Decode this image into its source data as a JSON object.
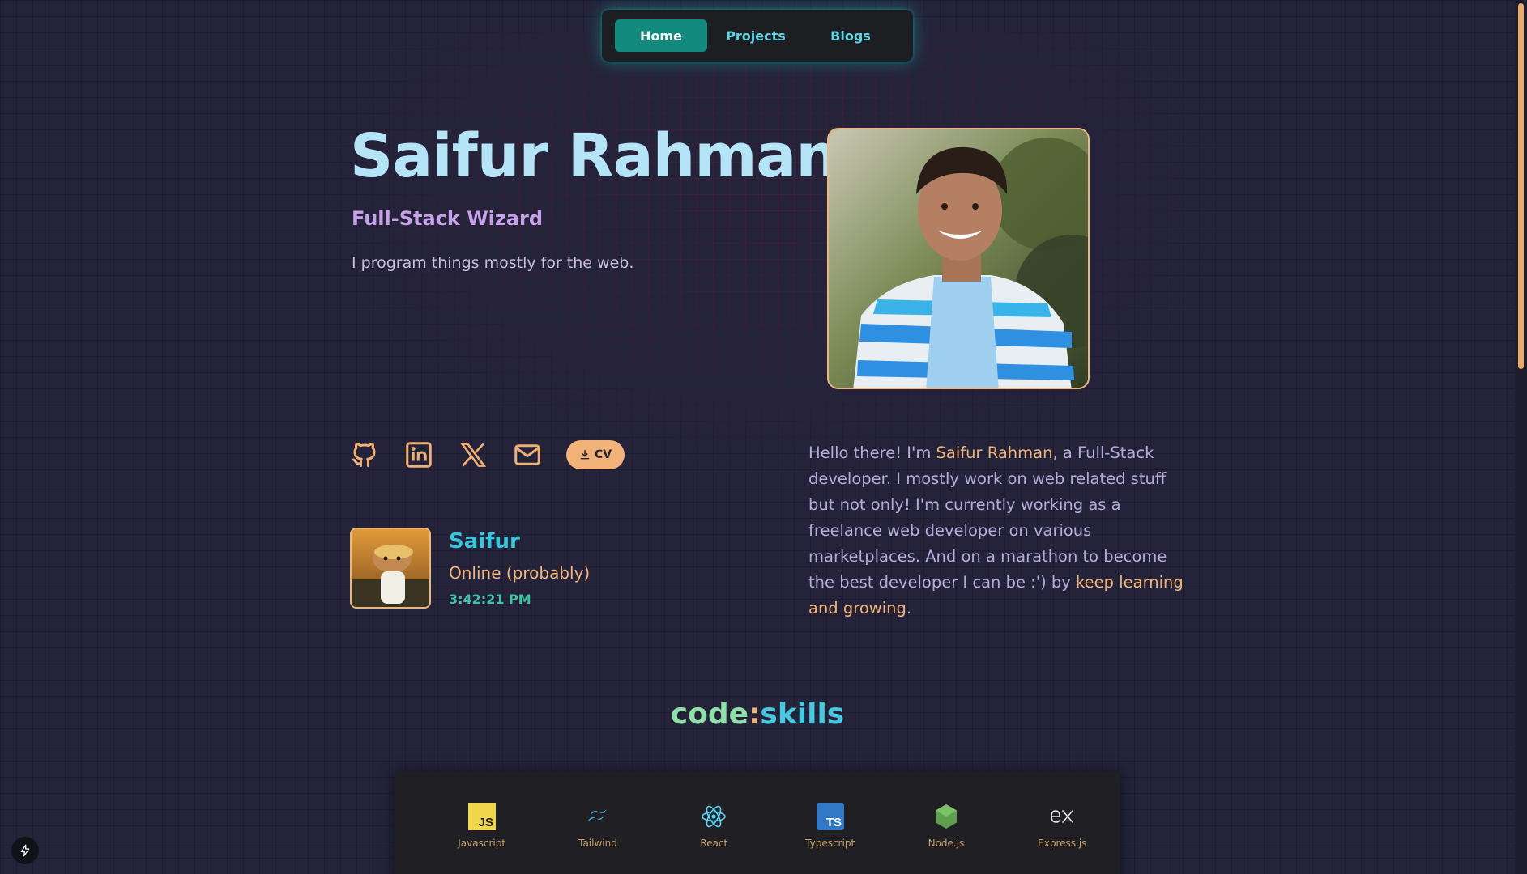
{
  "nav": {
    "items": [
      {
        "label": "Home",
        "active": true
      },
      {
        "label": "Projects",
        "active": false
      },
      {
        "label": "Blogs",
        "active": false
      }
    ]
  },
  "hero": {
    "name": "Saifur Rahman",
    "role": "Full-Stack Wizard",
    "tagline": "I program things mostly for the web."
  },
  "social": {
    "icons": [
      "github-icon",
      "linkedin-icon",
      "x-icon",
      "mail-icon"
    ],
    "cv_label": "CV"
  },
  "status": {
    "name": "Saifur",
    "state": "Online (probably)",
    "time": "3:42:21 PM"
  },
  "about": {
    "p1": "Hello there! I'm ",
    "name": "Saifur Rahman",
    "p2": ", a Full-Stack developer. I mostly work on web related stuff but not only! I'm currently working as a freelance web developer on various marketplaces. And on a marathon to become the best developer I can be :') by ",
    "highlight": "keep learning and growing",
    "p3": "."
  },
  "skills": {
    "title_part1": "code",
    "title_sep": ":",
    "title_part2": "skills",
    "items": [
      {
        "label": "Javascript",
        "icon": "javascript-icon"
      },
      {
        "label": "Tailwind",
        "icon": "tailwind-icon"
      },
      {
        "label": "React",
        "icon": "react-icon"
      },
      {
        "label": "Typescript",
        "icon": "typescript-icon"
      },
      {
        "label": "Node.js",
        "icon": "nodejs-icon"
      },
      {
        "label": "Express.js",
        "icon": "express-icon"
      }
    ]
  },
  "colors": {
    "background": "#24233a",
    "accent": "#128a7d",
    "highlight": "#f0b378",
    "name": "#b5e4f7"
  }
}
